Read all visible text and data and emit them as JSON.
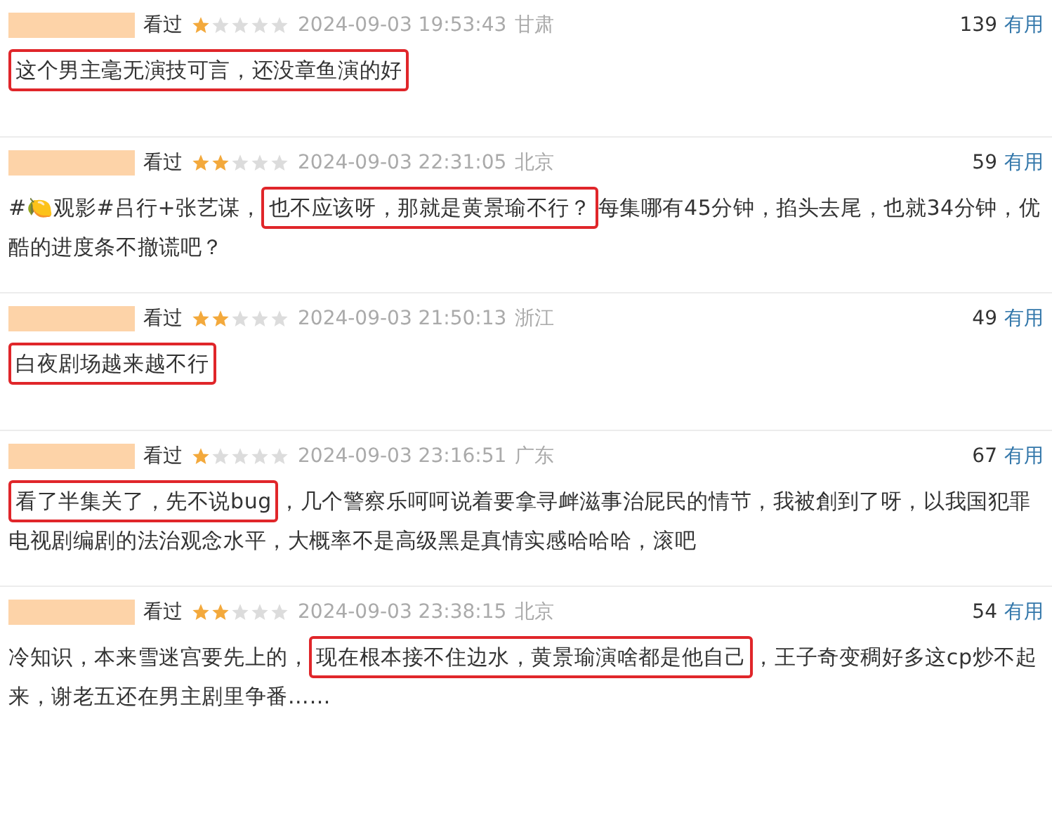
{
  "reviews": [
    {
      "status": "看过",
      "stars": 1,
      "time": "2024-09-03 19:53:43",
      "region": "甘肃",
      "votes": "139",
      "useful": "有用",
      "text": [
        {
          "text": "这个男主毫无演技可言，还没章鱼演的好",
          "highlighted": true
        }
      ]
    },
    {
      "status": "看过",
      "stars": 2,
      "time": "2024-09-03 22:31:05",
      "region": "北京",
      "votes": "59",
      "useful": "有用",
      "text": [
        {
          "text": "#🍋观影#吕行+张艺谋，",
          "highlighted": false
        },
        {
          "text": "也不应该呀，那就是黄景瑜不行？",
          "highlighted": true
        },
        {
          "text": "每集哪有45分钟，掐头去尾，也就34分钟，优酷的进度条不撤谎吧？",
          "highlighted": false
        }
      ]
    },
    {
      "status": "看过",
      "stars": 2,
      "time": "2024-09-03 21:50:13",
      "region": "浙江",
      "votes": "49",
      "useful": "有用",
      "text": [
        {
          "text": "白夜剧场越来越不行",
          "highlighted": true
        }
      ]
    },
    {
      "status": "看过",
      "stars": 1,
      "time": "2024-09-03 23:16:51",
      "region": "广东",
      "votes": "67",
      "useful": "有用",
      "text": [
        {
          "text": "看了半集关了，先不说bug",
          "highlighted": true
        },
        {
          "text": "，几个警察乐呵呵说着要拿寻衅滋事治屁民的情节，我被創到了呀，以我国犯罪电视剧编剧的法治观念水平，大概率不是高级黑是真情实感哈哈哈，滚吧",
          "highlighted": false
        }
      ]
    },
    {
      "status": "看过",
      "stars": 2,
      "time": "2024-09-03 23:38:15",
      "region": "北京",
      "votes": "54",
      "useful": "有用",
      "text": [
        {
          "text": "冷知识，本来雪迷宫要先上的，",
          "highlighted": false
        },
        {
          "text": "现在根本接不住边水，黄景瑜演啥都是他自己",
          "highlighted": true
        },
        {
          "text": "，王子奇变稠好多这cp炒不起来，谢老五还在男主剧里争番……",
          "highlighted": false
        }
      ]
    }
  ]
}
